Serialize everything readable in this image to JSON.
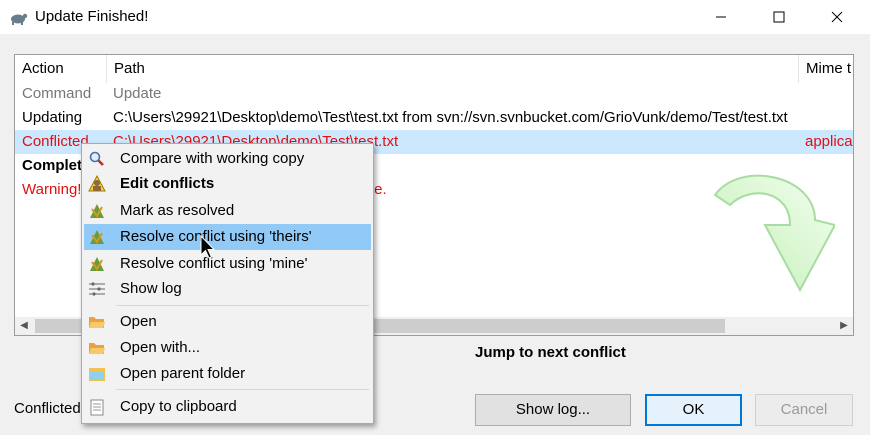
{
  "window": {
    "title": "Update Finished!"
  },
  "list": {
    "headers": {
      "action": "Action",
      "path": "Path",
      "mime": "Mime t"
    },
    "rows": [
      {
        "action": "Command",
        "path": "Update",
        "mime": ""
      },
      {
        "action": "Updating",
        "path": "C:\\Users\\29921\\Desktop\\demo\\Test\\test.txt from svn://svn.svnbucket.com/GrioVunk/demo/Test/test.txt",
        "mime": ""
      },
      {
        "action": "Conflicted",
        "path": "C:\\Users\\29921\\Desktop\\demo\\Test\\test.txt",
        "mime": "applica"
      },
      {
        "action": "Complet",
        "path": "",
        "mime": ""
      },
      {
        "action": "Warning!",
        "path": "te.",
        "mime": ""
      }
    ]
  },
  "context_menu": {
    "items": [
      {
        "label": "Compare with working copy",
        "icon": "magnifier-icon"
      },
      {
        "label": "Edit conflicts",
        "icon": "edit-conflicts-icon"
      },
      {
        "label": "Mark as resolved",
        "icon": "resolve-icon"
      },
      {
        "label": "Resolve conflict using 'theirs'",
        "icon": "resolve-icon"
      },
      {
        "label": "Resolve conflict using 'mine'",
        "icon": "resolve-icon"
      },
      {
        "label": "Show log",
        "icon": "log-icon"
      },
      {
        "label": "Open",
        "icon": "folder-open-icon"
      },
      {
        "label": "Open with...",
        "icon": "folder-open-icon"
      },
      {
        "label": "Open parent folder",
        "icon": "folder-icon"
      },
      {
        "label": "Copy to clipboard",
        "icon": "clipboard-icon"
      }
    ],
    "highlighted_index": 3
  },
  "jump_label": "Jump to next conflict",
  "status_text": "Conflicted",
  "buttons": {
    "show_log": "Show log...",
    "ok": "OK",
    "cancel": "Cancel"
  },
  "colors": {
    "conflict_red": "#e01010",
    "selection": "#cce8ff",
    "menu_highlight": "#91c9f7",
    "default_button_border": "#0078d7"
  }
}
